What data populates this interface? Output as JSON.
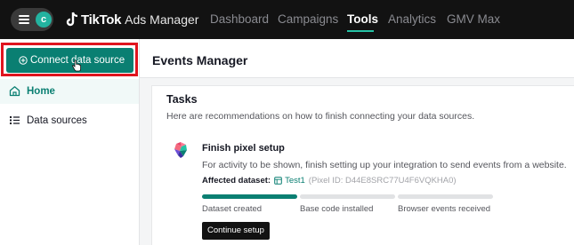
{
  "topbar": {
    "account_initial": "c",
    "brand": "TikTok",
    "product": "Ads Manager",
    "nav": [
      {
        "label": "Dashboard",
        "active": false
      },
      {
        "label": "Campaigns",
        "active": false
      },
      {
        "label": "Tools",
        "active": true
      },
      {
        "label": "Analytics",
        "active": false
      },
      {
        "label": "GMV Max",
        "active": false
      }
    ]
  },
  "sidebar": {
    "connect_button": "Connect data source",
    "items": [
      {
        "label": "Home",
        "icon": "home-icon",
        "active": true
      },
      {
        "label": "Data sources",
        "icon": "list-icon",
        "active": false
      }
    ]
  },
  "main": {
    "title": "Events Manager",
    "tasks": {
      "title": "Tasks",
      "description": "Here are recommendations on how to finish connecting your data sources.",
      "task": {
        "title": "Finish pixel setup",
        "description": "For activity to be shown, finish setting up your integration to send events from a website.",
        "dataset_label": "Affected dataset:",
        "dataset_name": "Test1",
        "pixel_id": "(Pixel ID: D44E8SRC77U4F6VQKHA0)",
        "progress_fraction": 0.333,
        "steps": [
          {
            "label": "Dataset created",
            "done": true
          },
          {
            "label": "Base code installed",
            "done": false
          },
          {
            "label": "Browser events received",
            "done": false
          }
        ],
        "button": "Continue setup"
      }
    }
  },
  "colors": {
    "accent": "#0a7f72",
    "highlight": "#e0141e",
    "topbar": "#121212"
  }
}
